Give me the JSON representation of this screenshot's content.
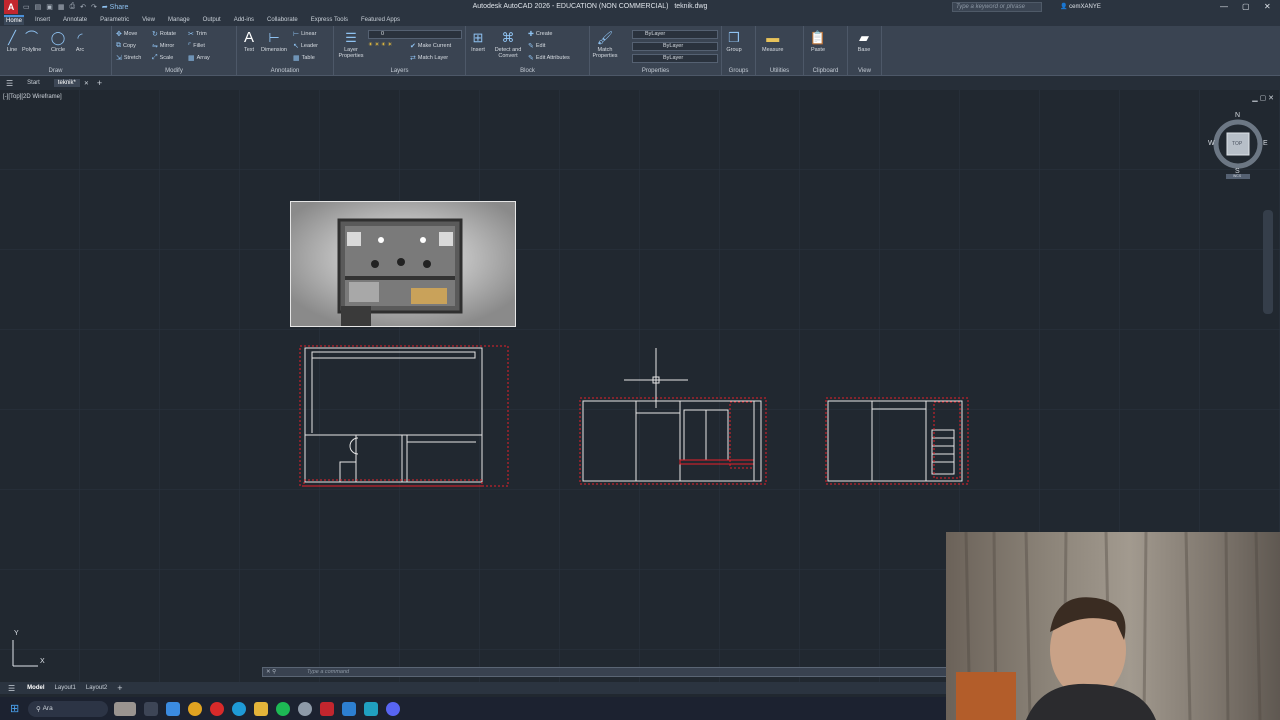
{
  "app": {
    "title": "Autodesk AutoCAD 2026 - EDUCATION (NON COMMERCIAL)",
    "file": "teknik.dwg",
    "share_label": "Share",
    "search_placeholder": "Type a keyword or phrase",
    "user": "cemXANYE"
  },
  "ribbon_tabs": [
    "Home",
    "Insert",
    "Annotate",
    "Parametric",
    "View",
    "Manage",
    "Output",
    "Add-ins",
    "Collaborate",
    "Express Tools",
    "Featured Apps"
  ],
  "active_ribbon_tab": "Home",
  "ribbon": {
    "draw": {
      "label": "Draw",
      "tools": [
        "Line",
        "Polyline",
        "Circle",
        "Arc"
      ]
    },
    "modify": {
      "label": "Modify",
      "rows": [
        "Move",
        "Copy",
        "Stretch",
        "Rotate",
        "Mirror",
        "Scale",
        "Trim",
        "Fillet",
        "Array"
      ]
    },
    "annotation": {
      "label": "Annotation",
      "text": "Text",
      "dimension": "Dimension",
      "rows": [
        "Linear",
        "Leader",
        "Table"
      ]
    },
    "layers": {
      "label": "Layers",
      "layer_properties": "Layer Properties",
      "combo": "0",
      "make_current": "Make Current",
      "match_layer": "Match Layer"
    },
    "block": {
      "label": "Block",
      "insert": "Insert",
      "detect_convert": "Detect and Convert",
      "rows": [
        "Create",
        "Edit",
        "Edit Attributes"
      ]
    },
    "properties": {
      "label": "Properties",
      "match": "Match Properties",
      "combos": [
        "ByLayer",
        "ByLayer",
        "ByLayer"
      ]
    },
    "groups": {
      "label": "Groups",
      "group": "Group"
    },
    "utilities": {
      "label": "Utilities",
      "measure": "Measure"
    },
    "clipboard": {
      "label": "Clipboard",
      "paste": "Paste"
    },
    "view": {
      "label": "View",
      "base": "Base"
    }
  },
  "doc_tabs": [
    "Start",
    "teknik*"
  ],
  "active_doc_tab": "teknik*",
  "viewport_label": "[-][Top][2D Wireframe]",
  "viewcube": {
    "n": "N",
    "s": "S",
    "e": "E",
    "w": "W",
    "face": "TOP",
    "wcs": "WCS"
  },
  "ucs": {
    "x": "X",
    "y": "Y"
  },
  "command_placeholder": "Type a command",
  "layout_tabs": [
    "Model",
    "Layout1",
    "Layout2"
  ],
  "active_layout": "Model",
  "taskbar": {
    "search": "Ara"
  },
  "colors": {
    "accent": "#c2262e",
    "selection": "#e8202a",
    "canvas": "#212830",
    "ribbon": "#3a4452"
  }
}
